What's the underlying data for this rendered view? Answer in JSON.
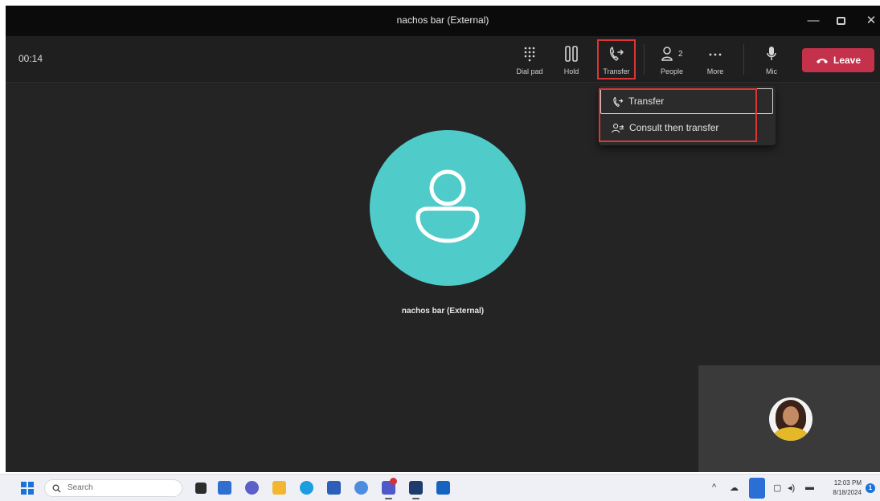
{
  "window": {
    "title": "nachos bar (External)",
    "controls": {
      "minimize": "—",
      "close": "✕"
    }
  },
  "toolbar": {
    "timer": "00:14",
    "buttons": {
      "dialpad": "Dial pad",
      "hold": "Hold",
      "transfer": "Transfer",
      "people": "People",
      "people_count": "2",
      "more": "More",
      "mic": "Mic"
    },
    "leave": "Leave"
  },
  "transfer_menu": {
    "items": [
      {
        "label": "Transfer",
        "icon": "transfer-icon"
      },
      {
        "label": "Consult then transfer",
        "icon": "consult-transfer-icon"
      }
    ]
  },
  "stage": {
    "callee_name": "nachos bar (External)",
    "avatar_color": "#4fcbc9"
  },
  "taskbar": {
    "search_placeholder": "Search",
    "clock_time": "12:03 PM",
    "clock_date": "8/18/2024",
    "notification_count": "1"
  },
  "colors": {
    "leave": "#c4314b",
    "highlight": "#d93737",
    "background": "#242424"
  }
}
